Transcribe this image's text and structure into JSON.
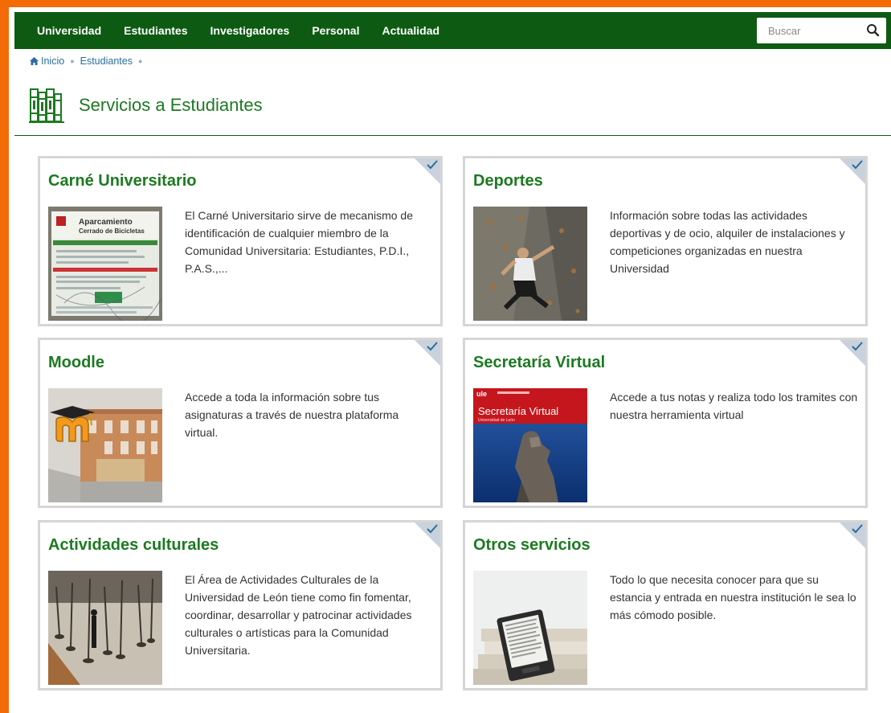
{
  "nav": {
    "items": [
      {
        "label": "Universidad"
      },
      {
        "label": "Estudiantes"
      },
      {
        "label": "Investigadores"
      },
      {
        "label": "Personal"
      },
      {
        "label": "Actualidad"
      }
    ],
    "search_placeholder": "Buscar"
  },
  "breadcrumb": {
    "home": "Inicio",
    "current": "Estudiantes"
  },
  "page": {
    "title": "Servicios a Estudiantes"
  },
  "cards": [
    {
      "title": "Carné Universitario",
      "text": "El Carné Universitario sirve de mecanismo de identificación de cualquier miembro de la Comunidad Universitaria: Estudiantes, P.D.I., P.A.S.,..."
    },
    {
      "title": "Deportes",
      "text": "Información sobre todas las actividades deportivas y de ocio, alquiler de instalaciones y competiciones organizadas en nuestra Universidad"
    },
    {
      "title": "Moodle",
      "text": "Accede a toda la información sobre tus asignaturas a través de nuestra plataforma virtual."
    },
    {
      "title": "Secretaría Virtual",
      "text": "Accede a tus notas y realiza todo los tramites con nuestra herramienta virtual"
    },
    {
      "title": "Actividades culturales",
      "text": "El Área de Actividades Culturales de la Universidad de León tiene como fin fomentar, coordinar, desarrollar y patrocinar actividades culturales o artísticas para la Comunidad Universitaria."
    },
    {
      "title": "Otros servicios",
      "text": "Todo lo que necesita conocer para que su estancia y entrada en nuestra institución le sea lo más cómodo posible."
    }
  ],
  "thumbs": {
    "carne": {
      "sign_title": "Aparcamiento",
      "sign_subtitle": "Cerrado de Bicicletas"
    },
    "secretaria": {
      "logo": "ule",
      "banner": "Secretaría Virtual",
      "banner_sub": "Universidad de León"
    }
  },
  "colors": {
    "nav_green": "#0d5b12",
    "title_green": "#1c7a21",
    "frame_orange": "#f26b06"
  }
}
